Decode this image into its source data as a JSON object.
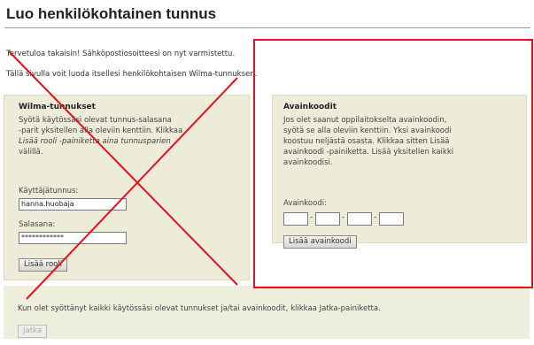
{
  "page": {
    "title": "Luo henkilökohtainen tunnus",
    "welcome_text": "Tervetuloa takaisin! Sähköpostiosoitteesi on nyt varmistettu.",
    "intro_text": "Tällä sivulla voit luoda itsellesi henkilökohtaisen Wilma-tunnuksen."
  },
  "wilma_panel": {
    "heading": "Wilma-tunnukset",
    "desc_lines": [
      "Syötä käytössäsi olevat tunnus-salasana",
      "-parit yksitellen alla oleviin kenttiin. Klikkaa",
      "Lisää rooli -painiketta aina tunnusparien",
      "välillä."
    ],
    "username_label": "Käyttäjätunnus:",
    "username_value": "hanna.huobaja",
    "password_label": "Salasana:",
    "password_value": "************",
    "add_role_label": "Lisää rooli"
  },
  "avain_panel": {
    "heading": "Avainkoodit",
    "desc_lines": [
      "Jos olet saanut oppilaitokselta avainkoodin,",
      "syötä se alla oleviin kenttiin. Yksi avainkoodi",
      "koostuu neljästä osasta. Klikkaa sitten Lisää",
      "avainkoodi -painiketta. Lisää yksitellen kaikki",
      "avainkoodisi."
    ],
    "codes_label": "Avainkoodi:",
    "add_code_label": "Lisää avainkoodi"
  },
  "bottom_panel": {
    "instruction": "Kun olet syöttänyt kaikki käytössäsi olevat tunnukset ja/tai avainkoodit, klikkaa Jatka-painiketta.",
    "continue_label": "Jatka"
  },
  "annotation": {
    "highlight_color": "#e8101a",
    "cross_color": "#e8101a"
  }
}
